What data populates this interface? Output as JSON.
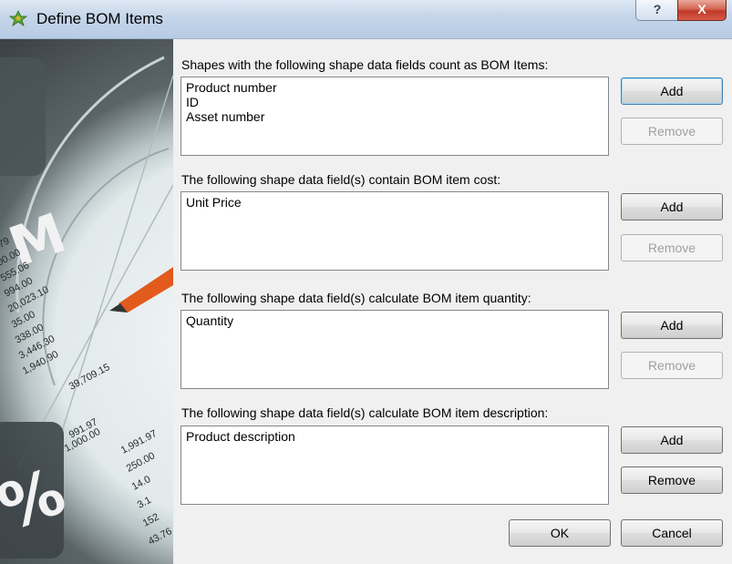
{
  "window": {
    "title": "Define BOM Items",
    "help_label": "?",
    "close_label": "X"
  },
  "sections": [
    {
      "label": "Shapes with the following shape data fields count as BOM Items:",
      "items": [
        "Product number",
        "ID",
        "Asset number"
      ],
      "add_label": "Add",
      "remove_label": "Remove"
    },
    {
      "label": "The following shape data field(s) contain BOM item cost:",
      "items": [
        "Unit Price"
      ],
      "add_label": "Add",
      "remove_label": "Remove"
    },
    {
      "label": "The following shape data field(s) calculate BOM item quantity:",
      "items": [
        "Quantity"
      ],
      "add_label": "Add",
      "remove_label": "Remove"
    },
    {
      "label": "The following shape data field(s) calculate BOM item description:",
      "items": [
        "Product description"
      ],
      "add_label": "Add",
      "remove_label": "Remove"
    }
  ],
  "footer": {
    "ok_label": "OK",
    "cancel_label": "Cancel"
  },
  "sidebar_image_text": [
    "379",
    "00.00",
    "555.06",
    "994.00",
    "20,023.10",
    "35.00",
    "338.00",
    "3,446.30",
    "1,940.90",
    "39,709.15",
    "991.97",
    "1,000.00",
    "1,991.97",
    "250.00",
    "14.0",
    "3.1",
    "152",
    "43.76"
  ]
}
